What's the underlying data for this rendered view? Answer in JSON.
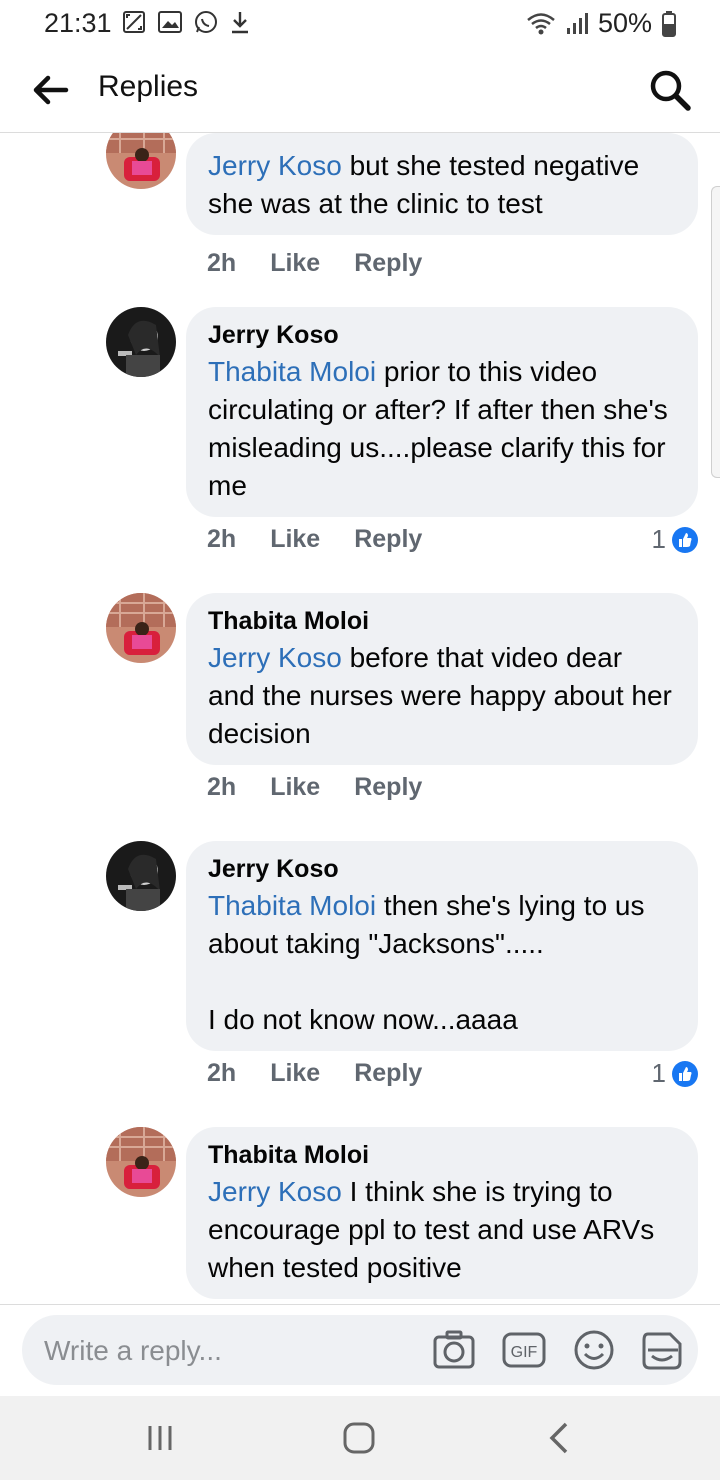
{
  "status": {
    "time": "21:31",
    "battery": "50%"
  },
  "header": {
    "title": "Replies"
  },
  "comments": [
    {
      "author": "",
      "mention": "Jerry Koso",
      "text": " but she tested negative she was at the clinic to test",
      "time": "2h",
      "like": "Like",
      "reply": "Reply",
      "reactions": ""
    },
    {
      "author": "Jerry Koso",
      "mention": "Thabita Moloi",
      "text": " prior to this video circulating or after? If after then she's misleading us....please clarify this for me",
      "time": "2h",
      "like": "Like",
      "reply": "Reply",
      "reactions": "1"
    },
    {
      "author": "Thabita Moloi",
      "mention": "Jerry Koso",
      "text": " before that video dear and the nurses were happy about her decision",
      "time": "2h",
      "like": "Like",
      "reply": "Reply",
      "reactions": ""
    },
    {
      "author": "Jerry Koso",
      "mention": "Thabita Moloi",
      "text": " then she's lying to us about taking \"Jacksons\".....\n\nI do not know now...aaaa",
      "time": "2h",
      "like": "Like",
      "reply": "Reply",
      "reactions": "1"
    },
    {
      "author": "Thabita Moloi",
      "mention": "Jerry Koso",
      "text": " I think she is trying to encourage ppl to test and use ARVs when tested positive",
      "time": "",
      "like": "",
      "reply": "",
      "reactions": ""
    }
  ],
  "compose": {
    "placeholder": "Write a reply..."
  },
  "icons": {
    "back": "arrow-left-icon",
    "search": "search-icon",
    "camera": "camera-icon",
    "gif": "gif-icon",
    "emoji": "emoji-icon",
    "sticker": "sticker-icon",
    "like": "like-thumb-icon"
  },
  "colors": {
    "mention": "#2d6fb8",
    "bubble": "#eff1f4",
    "like_badge": "#1877f2"
  }
}
